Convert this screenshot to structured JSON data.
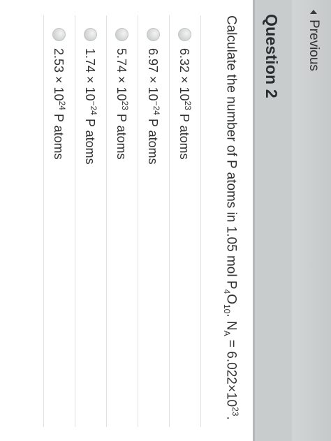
{
  "question": {
    "title": "Question 2",
    "text_prefix": "Calculate the number of P atoms in 1.05 mol P",
    "formula_sub_4": "4",
    "formula_O": "O",
    "formula_sub_10": "10",
    "text_mid": ". N",
    "na_sub": "A",
    "text_suffix": " = 6.022×10",
    "exponent": "23",
    "end_punct": "."
  },
  "answers": [
    {
      "mantissa": "6.32 × 10",
      "exponent": "23",
      "unit": " P atoms"
    },
    {
      "mantissa": "6.97 × 10",
      "exponent": "−24",
      "unit": " P atoms"
    },
    {
      "mantissa": "5.74 × 10",
      "exponent": "23",
      "unit": " P atoms"
    },
    {
      "mantissa": "1.74 × 10",
      "exponent": "−24",
      "unit": " P atoms"
    },
    {
      "mantissa": "2.53 × 10",
      "exponent": "24",
      "unit": " P atoms"
    }
  ],
  "navigation": {
    "previous_label": "Previous",
    "previous_icon": "triangle-left-icon"
  },
  "colors": {
    "background": "#d2d5d6",
    "card": "#ffffff",
    "header": "#c9cccd",
    "text": "#2f3133"
  }
}
